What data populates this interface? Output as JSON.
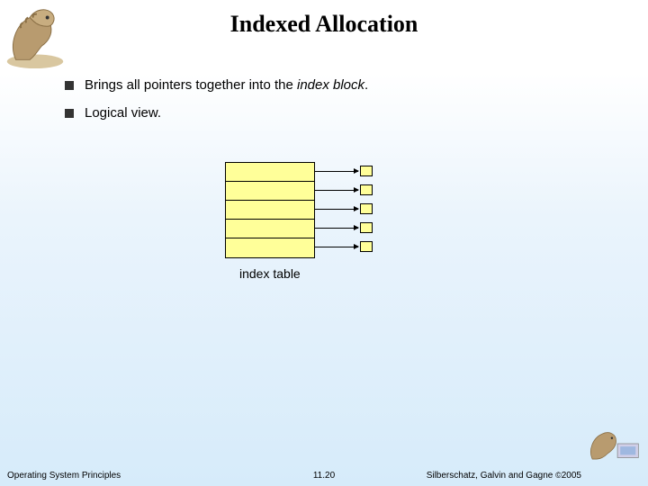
{
  "title": "Indexed Allocation",
  "bullets": [
    {
      "pre": "Brings all pointers together into the ",
      "em": "index block",
      "post": "."
    },
    {
      "pre": "Logical view.",
      "em": "",
      "post": ""
    }
  ],
  "diagram": {
    "label": "index table",
    "row_count": 5
  },
  "footer": {
    "left": "Operating System Principles",
    "center": "11.20",
    "right_prefix": "Silberschatz, Galvin and Gagne ",
    "right_copy": "©",
    "right_year": "2005"
  }
}
